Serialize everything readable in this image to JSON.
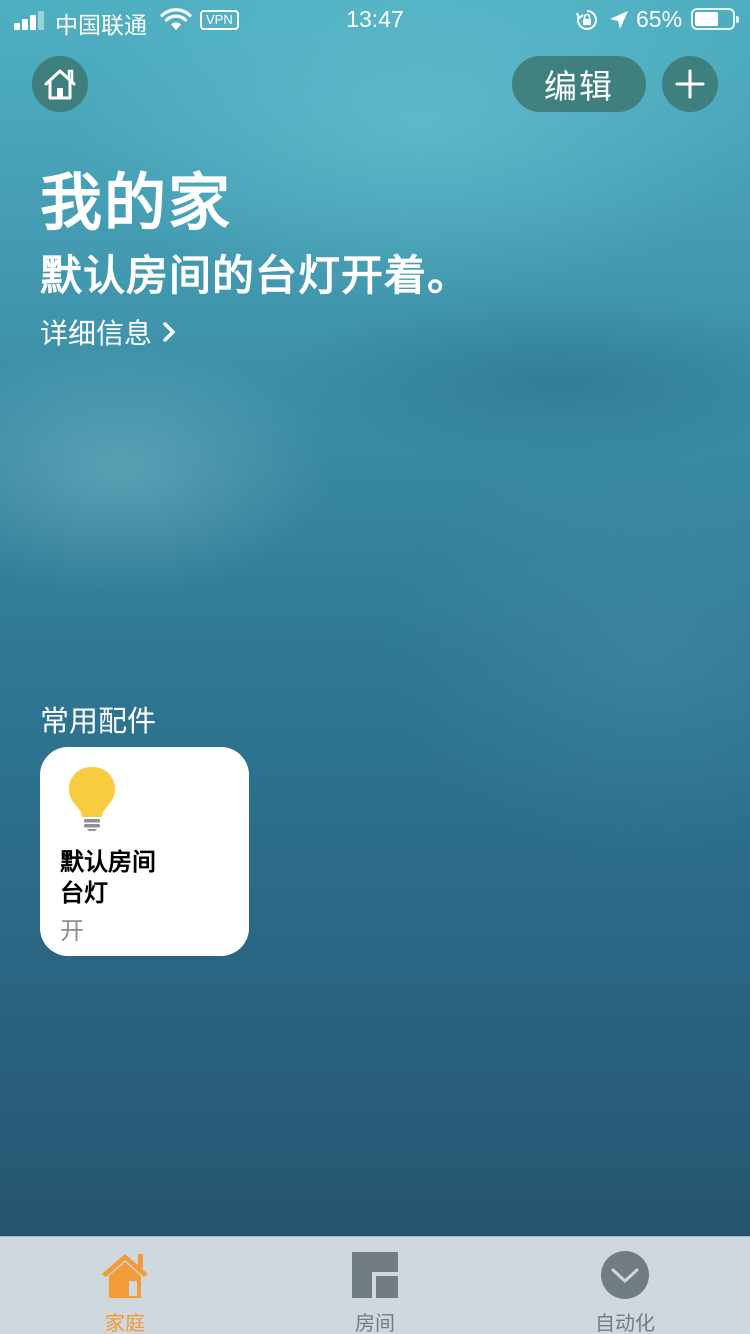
{
  "status_bar": {
    "carrier": "中国联通",
    "vpn": "VPN",
    "time": "13:47",
    "battery_percent": "65%",
    "battery_level": 0.65,
    "icons": [
      "signal-icon",
      "wifi-icon",
      "rotation-lock-icon",
      "location-arrow-icon",
      "battery-icon"
    ]
  },
  "header": {
    "home_icon": "home-icon",
    "edit_label": "编辑",
    "add_icon": "plus-icon"
  },
  "home": {
    "title": "我的家",
    "summary": "默认房间的台灯开着。",
    "details_label": "详细信息"
  },
  "favorites": {
    "section_title": "常用配件",
    "accessories": [
      {
        "room": "默认房间",
        "name": "台灯",
        "state": "开",
        "icon": "lightbulb-icon",
        "icon_color": "#f9cb3f"
      }
    ]
  },
  "tab_bar": {
    "active_color": "#f29b38",
    "inactive_color": "#727c83",
    "tabs": [
      {
        "label": "家庭",
        "icon": "house-icon",
        "active": true
      },
      {
        "label": "房间",
        "icon": "rooms-icon",
        "active": false
      },
      {
        "label": "自动化",
        "icon": "automation-icon",
        "active": false
      }
    ]
  }
}
